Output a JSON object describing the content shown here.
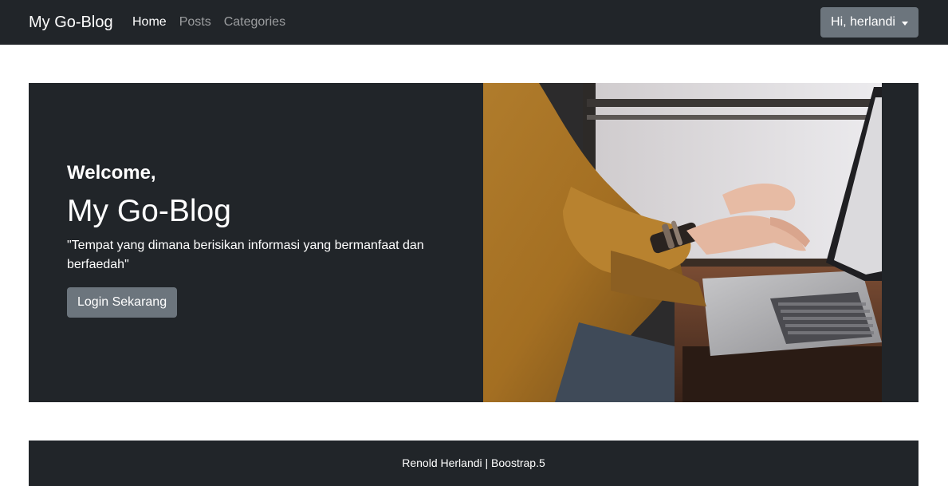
{
  "navbar": {
    "brand": "My Go-Blog",
    "links": [
      {
        "label": "Home",
        "active": true
      },
      {
        "label": "Posts",
        "active": false
      },
      {
        "label": "Categories",
        "active": false
      }
    ],
    "user_menu_label": "Hi, herlandi"
  },
  "hero": {
    "welcome": "Welcome,",
    "title": "My Go-Blog",
    "tagline": "\"Tempat yang dimana berisikan informasi yang bermanfaat dan berfaedah\"",
    "login_button": "Login Sekarang"
  },
  "footer": {
    "text": "Renold Herlandi | Boostrap.5"
  },
  "colors": {
    "dark": "#212529",
    "secondary": "#6c757d"
  }
}
